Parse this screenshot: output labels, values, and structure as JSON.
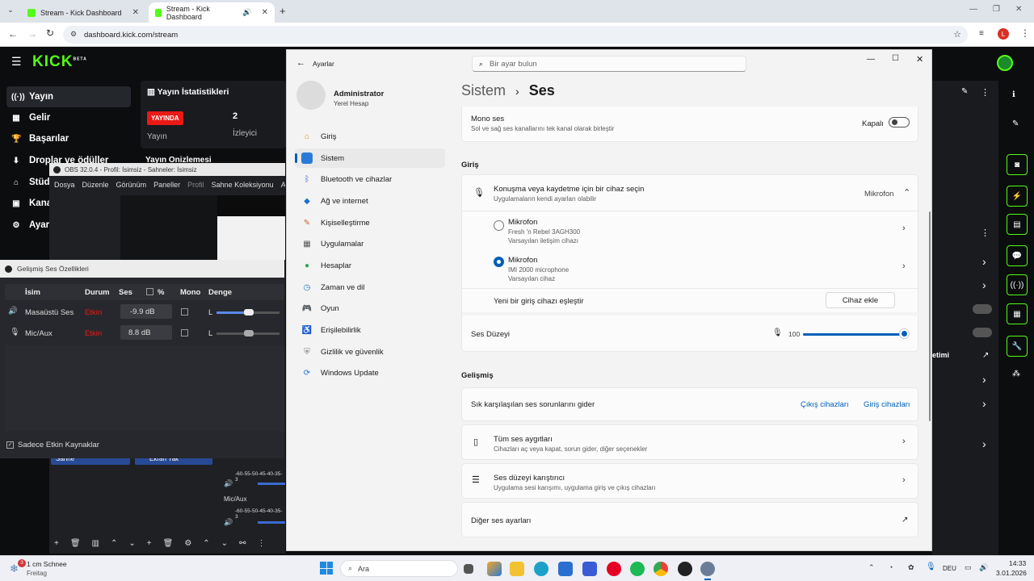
{
  "browser": {
    "tabs": [
      "Stream - Kick Dashboard",
      "Stream - Kick Dashboard"
    ],
    "url": "dashboard.kick.com/stream",
    "profile_initial": "L"
  },
  "kick": {
    "logo": "KICK",
    "beta": "BETA",
    "nav": [
      "Yayın",
      "Gelir",
      "Başarılar",
      "Droplar ve ödüller",
      "Stüd",
      "Kana",
      "Ayar"
    ],
    "stats_title": "Yayın İstatistikleri",
    "live_badge": "YAYINDA",
    "stat_label": "Yayın",
    "viewers": "2",
    "viewers_label": "İzleyici",
    "partial_title": "Yayın Önizlemesi",
    "partial_right": "etimi"
  },
  "obs": {
    "title": "OBS 32.0.4 - Profil: İsimsiz - Sahneler: İsimsiz",
    "menu": [
      "Dosya",
      "Düzenle",
      "Görünüm",
      "Paneller",
      "Profil",
      "Sahne Koleksiyonu",
      "A"
    ],
    "scene": "Sahne",
    "source": "Ekran Yak",
    "micaux": "Mic/Aux",
    "meter": "-60-55-50-45-40-35-3"
  },
  "adv": {
    "title": "Gelişmiş Ses Özellikleri",
    "cols": [
      "İsim",
      "Durum",
      "Ses",
      "%",
      "Mono",
      "Denge"
    ],
    "rows": [
      {
        "name": "Masaüstü Ses",
        "status": "Etkin",
        "vol": "-9.9 dB",
        "bal": "L"
      },
      {
        "name": "Mic/Aux",
        "status": "Etkin",
        "vol": "8.8 dB",
        "bal": "L"
      }
    ],
    "only_active": "Sadece Etkin Kaynaklar"
  },
  "settings": {
    "app": "Ayarlar",
    "search_placeholder": "Bir ayar bulun",
    "user": "Administrator",
    "account": "Yerel Hesap",
    "nav": [
      "Giriş",
      "Sistem",
      "Bluetooth ve cihazlar",
      "Ağ ve internet",
      "Kişiselleştirme",
      "Uygulamalar",
      "Hesaplar",
      "Zaman ve dil",
      "Oyun",
      "Erişilebilirlik",
      "Gizlilik ve güvenlik",
      "Windows Update"
    ],
    "crumb_parent": "Sistem",
    "crumb_sep": "›",
    "crumb_current": "Ses",
    "mono_title": "Mono ses",
    "mono_desc": "Sol ve sağ ses kanallarını tek kanal olarak birleştir",
    "mono_state": "Kapalı",
    "input_section": "Giriş",
    "choose_title": "Konuşma veya kaydetme için bir cihaz seçin",
    "choose_desc": "Uygulamaların kendi ayarları olabilir",
    "choose_value": "Mikrofon",
    "devices": [
      {
        "name": "Mikrofon",
        "model": "Fresh 'n Rebel 3AGH300",
        "role": "Varsayılan iletişim cihazı",
        "selected": false
      },
      {
        "name": "Mikrofon",
        "model": "IMI 2000 microphone",
        "role": "Varsayılan cihaz",
        "selected": true
      }
    ],
    "pair_label": "Yeni bir giriş cihazı eşleştir",
    "add_device": "Cihaz ekle",
    "level_label": "Ses Düzeyi",
    "level_value": "100",
    "level_fraction": 1.0,
    "advanced": "Gelişmiş",
    "troubleshoot": "Sık karşılaşılan ses sorunlarını gider",
    "out_dev": "Çıkış cihazları",
    "in_dev": "Giriş cihazları",
    "all_title": "Tüm ses aygıtları",
    "all_desc": "Cihazları aç veya kapat, sorun gider, diğer seçenekler",
    "mixer_title": "Ses düzeyi karıştırıcı",
    "mixer_desc": "Uygulama sesi karışımı, uygulama giriş ve çıkış cihazları",
    "more": "Diğer ses ayarları"
  },
  "taskbar": {
    "weather": "1 cm Schnee",
    "day": "Freitag",
    "badge": "3",
    "search": "Ara",
    "lang": "DEU",
    "time": "14:33",
    "date": "3.01.2026"
  },
  "colors": {
    "accent": "#005fb8",
    "kick_green": "#53fc18",
    "live_red": "#e91916"
  }
}
